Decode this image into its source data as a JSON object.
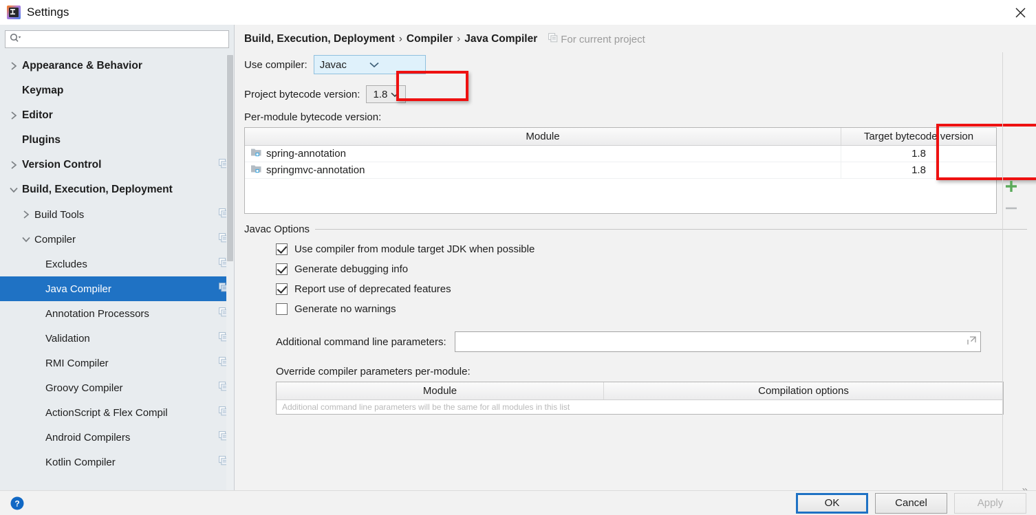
{
  "window": {
    "title": "Settings",
    "logo_icon": "intellij-logo-icon",
    "close_icon": "close-icon"
  },
  "sidebar": {
    "search": {
      "placeholder": "",
      "value": "",
      "icon": "search-icon"
    },
    "items": [
      {
        "label": "Appearance & Behavior",
        "level": 0,
        "arrow": "collapsed",
        "copy": false,
        "selected": false
      },
      {
        "label": "Keymap",
        "level": 0,
        "arrow": "none",
        "copy": false,
        "selected": false
      },
      {
        "label": "Editor",
        "level": 0,
        "arrow": "collapsed",
        "copy": false,
        "selected": false
      },
      {
        "label": "Plugins",
        "level": 0,
        "arrow": "none",
        "copy": false,
        "selected": false
      },
      {
        "label": "Version Control",
        "level": 0,
        "arrow": "collapsed",
        "copy": true,
        "selected": false
      },
      {
        "label": "Build, Execution, Deployment",
        "level": 0,
        "arrow": "expanded",
        "copy": false,
        "selected": false
      },
      {
        "label": "Build Tools",
        "level": 1,
        "arrow": "collapsed",
        "copy": true,
        "selected": false
      },
      {
        "label": "Compiler",
        "level": 1,
        "arrow": "expanded",
        "copy": true,
        "selected": false
      },
      {
        "label": "Excludes",
        "level": 2,
        "arrow": "none",
        "copy": true,
        "selected": false
      },
      {
        "label": "Java Compiler",
        "level": 2,
        "arrow": "none",
        "copy": true,
        "selected": true
      },
      {
        "label": "Annotation Processors",
        "level": 2,
        "arrow": "none",
        "copy": true,
        "selected": false
      },
      {
        "label": "Validation",
        "level": 2,
        "arrow": "none",
        "copy": true,
        "selected": false
      },
      {
        "label": "RMI Compiler",
        "level": 2,
        "arrow": "none",
        "copy": true,
        "selected": false
      },
      {
        "label": "Groovy Compiler",
        "level": 2,
        "arrow": "none",
        "copy": true,
        "selected": false
      },
      {
        "label": "ActionScript & Flex Compil",
        "level": 2,
        "arrow": "none",
        "copy": true,
        "selected": false
      },
      {
        "label": "Android Compilers",
        "level": 2,
        "arrow": "none",
        "copy": true,
        "selected": false
      },
      {
        "label": "Kotlin Compiler",
        "level": 2,
        "arrow": "none",
        "copy": true,
        "selected": false
      }
    ]
  },
  "breadcrumb": {
    "part1": "Build, Execution, Deployment",
    "part2": "Compiler",
    "part3": "Java Compiler",
    "separator": "›",
    "scope_label": "For current project",
    "scope_icon": "module-copy-icon"
  },
  "compiler": {
    "use_compiler_label": "Use compiler:",
    "use_compiler_value": "Javac",
    "project_bytecode_label": "Project bytecode version:",
    "project_bytecode_value": "1.8",
    "per_module_label": "Per-module bytecode version:"
  },
  "module_table": {
    "columns": [
      "Module",
      "Target bytecode version"
    ],
    "rows": [
      {
        "module": "spring-annotation",
        "target": "1.8"
      },
      {
        "module": "springmvc-annotation",
        "target": "1.8"
      }
    ],
    "add_button": "+",
    "remove_button": "−"
  },
  "javac_options": {
    "legend": "Javac Options",
    "checkboxes": [
      {
        "label": "Use compiler from module target JDK when possible",
        "checked": true
      },
      {
        "label": "Generate debugging info",
        "checked": true
      },
      {
        "label": "Report use of deprecated features",
        "checked": true
      },
      {
        "label": "Generate no warnings",
        "checked": false
      }
    ],
    "params_label": "Additional command line parameters:",
    "params_value": "",
    "params_placeholder": "",
    "override_label": "Override compiler parameters per-module:",
    "override_columns": [
      "Module",
      "Compilation options"
    ],
    "override_hint": "Additional command line parameters will be the same for all modules in this list",
    "expand_icon": "chevron-double-right-icon"
  },
  "footer": {
    "help_icon": "help-icon",
    "ok_label": "OK",
    "cancel_label": "Cancel",
    "apply_label": "Apply"
  },
  "annotations": {
    "color": "#ee1111",
    "boxes": [
      "project-bytecode-version",
      "target-bytecode-version-column"
    ]
  }
}
